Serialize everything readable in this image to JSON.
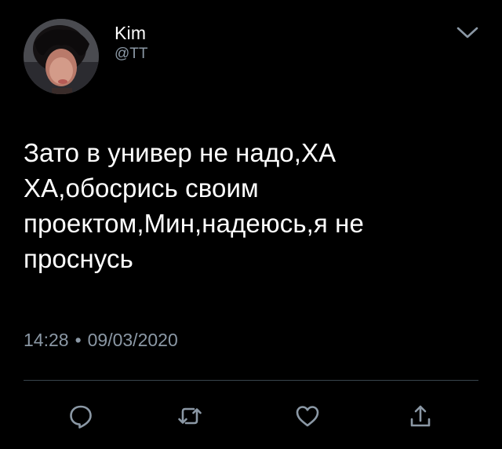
{
  "user": {
    "display_name": "Kim",
    "handle": "@TT"
  },
  "tweet": {
    "text": "Зато в универ не надо,ХА\nХА,обосрись своим\nпроектом,Мин,надеюсь,я не\nпроснусь",
    "time": "14:28",
    "separator": "•",
    "date": "09/03/2020"
  },
  "icons": {
    "menu": "chevron-down-icon",
    "reply": "reply-icon",
    "retweet": "retweet-icon",
    "like": "like-icon",
    "share": "share-icon"
  },
  "colors": {
    "background": "#000000",
    "text": "#ffffff",
    "secondary": "#8b98a5",
    "divider": "#38444d"
  }
}
